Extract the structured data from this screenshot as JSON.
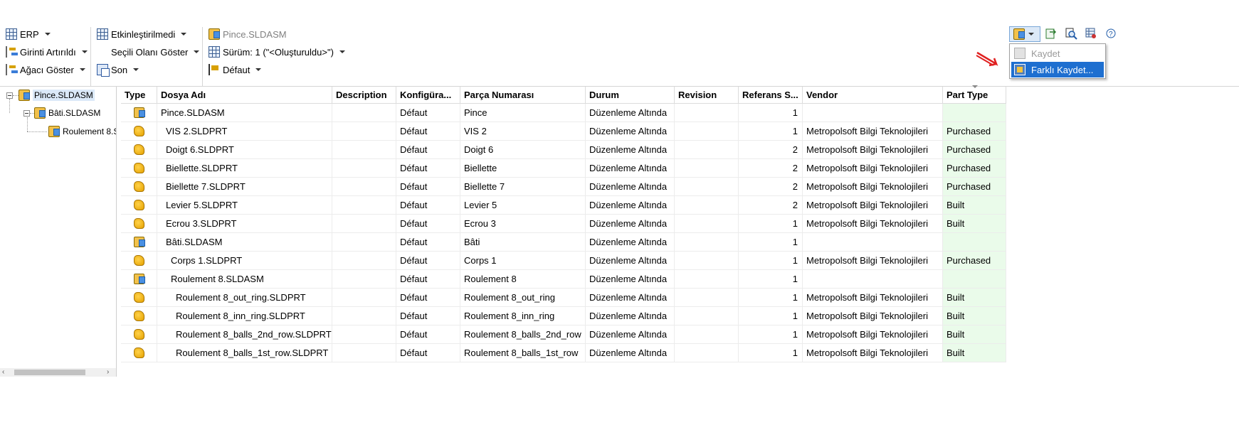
{
  "ribbon": {
    "erp_label": "ERP",
    "indent_label": "Girinti Artırıldı",
    "tree_label": "Ağacı Göster",
    "activation_label": "Etkinleştirilmedi",
    "show_selected_label": "Seçili Olanı Göster",
    "last_label": "Son",
    "file_label": "Pince.SLDASM",
    "version_label": "Sürüm: 1 (\"<Oluşturuldu>\")",
    "config_label": "Défaut"
  },
  "save_menu": {
    "save_label": "Kaydet",
    "save_as_label": "Farklı Kaydet..."
  },
  "tree": {
    "root": "Pince.SLDASM",
    "child": "Bâti.SLDASM",
    "grandchild": "Roulement 8.S"
  },
  "grid": {
    "headers": [
      "Type",
      "Dosya Adı",
      "Description",
      "Konfigüra...",
      "Parça Numarası",
      "Durum",
      "Revision",
      "Referans S...",
      "Vendor",
      "Part Type"
    ],
    "rows": [
      {
        "type": "assembly",
        "file": "Pince.SLDASM",
        "description": "",
        "config": "Défaut",
        "part_number": "Pince",
        "status": "Düzenleme Altında",
        "revision": "",
        "refs": "1",
        "vendor": "",
        "part_type": ""
      },
      {
        "type": "part",
        "file": "VIS 2.SLDPRT",
        "description": "",
        "config": "Défaut",
        "part_number": "VIS 2",
        "status": "Düzenleme Altında",
        "revision": "",
        "refs": "1",
        "vendor": "Metropolsoft Bilgi Teknolojileri",
        "part_type": "Purchased"
      },
      {
        "type": "part",
        "file": "Doigt 6.SLDPRT",
        "description": "",
        "config": "Défaut",
        "part_number": "Doigt 6",
        "status": "Düzenleme Altında",
        "revision": "",
        "refs": "2",
        "vendor": "Metropolsoft Bilgi Teknolojileri",
        "part_type": "Purchased"
      },
      {
        "type": "part",
        "file": "Biellette.SLDPRT",
        "description": "",
        "config": "Défaut",
        "part_number": "Biellette",
        "status": "Düzenleme Altında",
        "revision": "",
        "refs": "2",
        "vendor": "Metropolsoft Bilgi Teknolojileri",
        "part_type": "Purchased"
      },
      {
        "type": "part",
        "file": "Biellette 7.SLDPRT",
        "description": "",
        "config": "Défaut",
        "part_number": "Biellette 7",
        "status": "Düzenleme Altında",
        "revision": "",
        "refs": "2",
        "vendor": "Metropolsoft Bilgi Teknolojileri",
        "part_type": "Purchased"
      },
      {
        "type": "part",
        "file": "Levier 5.SLDPRT",
        "description": "",
        "config": "Défaut",
        "part_number": "Levier 5",
        "status": "Düzenleme Altında",
        "revision": "",
        "refs": "2",
        "vendor": "Metropolsoft Bilgi Teknolojileri",
        "part_type": "Built"
      },
      {
        "type": "part",
        "file": "Ecrou 3.SLDPRT",
        "description": "",
        "config": "Défaut",
        "part_number": "Ecrou 3",
        "status": "Düzenleme Altında",
        "revision": "",
        "refs": "1",
        "vendor": "Metropolsoft Bilgi Teknolojileri",
        "part_type": "Built"
      },
      {
        "type": "assembly",
        "file": "Bâti.SLDASM",
        "description": "",
        "config": "Défaut",
        "part_number": "Bâti",
        "status": "Düzenleme Altında",
        "revision": "",
        "refs": "1",
        "vendor": "",
        "part_type": ""
      },
      {
        "type": "part",
        "file": "Corps 1.SLDPRT",
        "description": "",
        "config": "Défaut",
        "part_number": "Corps 1",
        "status": "Düzenleme Altında",
        "revision": "",
        "refs": "1",
        "vendor": "Metropolsoft Bilgi Teknolojileri",
        "part_type": "Purchased"
      },
      {
        "type": "assembly",
        "file": "Roulement 8.SLDASM",
        "description": "",
        "config": "Défaut",
        "part_number": "Roulement 8",
        "status": "Düzenleme Altında",
        "revision": "",
        "refs": "1",
        "vendor": "",
        "part_type": ""
      },
      {
        "type": "part",
        "file": "Roulement 8_out_ring.SLDPRT",
        "description": "",
        "config": "Défaut",
        "part_number": "Roulement 8_out_ring",
        "status": "Düzenleme Altında",
        "revision": "",
        "refs": "1",
        "vendor": "Metropolsoft Bilgi Teknolojileri",
        "part_type": "Built"
      },
      {
        "type": "part",
        "file": "Roulement 8_inn_ring.SLDPRT",
        "description": "",
        "config": "Défaut",
        "part_number": "Roulement 8_inn_ring",
        "status": "Düzenleme Altında",
        "revision": "",
        "refs": "1",
        "vendor": "Metropolsoft Bilgi Teknolojileri",
        "part_type": "Built"
      },
      {
        "type": "part",
        "file": "Roulement 8_balls_2nd_row.SLDPRT",
        "description": "",
        "config": "Défaut",
        "part_number": "Roulement 8_balls_2nd_row",
        "status": "Düzenleme Altında",
        "revision": "",
        "refs": "1",
        "vendor": "Metropolsoft Bilgi Teknolojileri",
        "part_type": "Built"
      },
      {
        "type": "part",
        "file": "Roulement 8_balls_1st_row.SLDPRT",
        "description": "",
        "config": "Défaut",
        "part_number": "Roulement 8_balls_1st_row",
        "status": "Düzenleme Altında",
        "revision": "",
        "refs": "1",
        "vendor": "Metropolsoft Bilgi Teknolojileri",
        "part_type": "Built"
      }
    ]
  },
  "colors": {
    "part_type_bg": "#eafbea",
    "selection": "#1e6fd0",
    "annotation_arrow": "#e02020"
  }
}
